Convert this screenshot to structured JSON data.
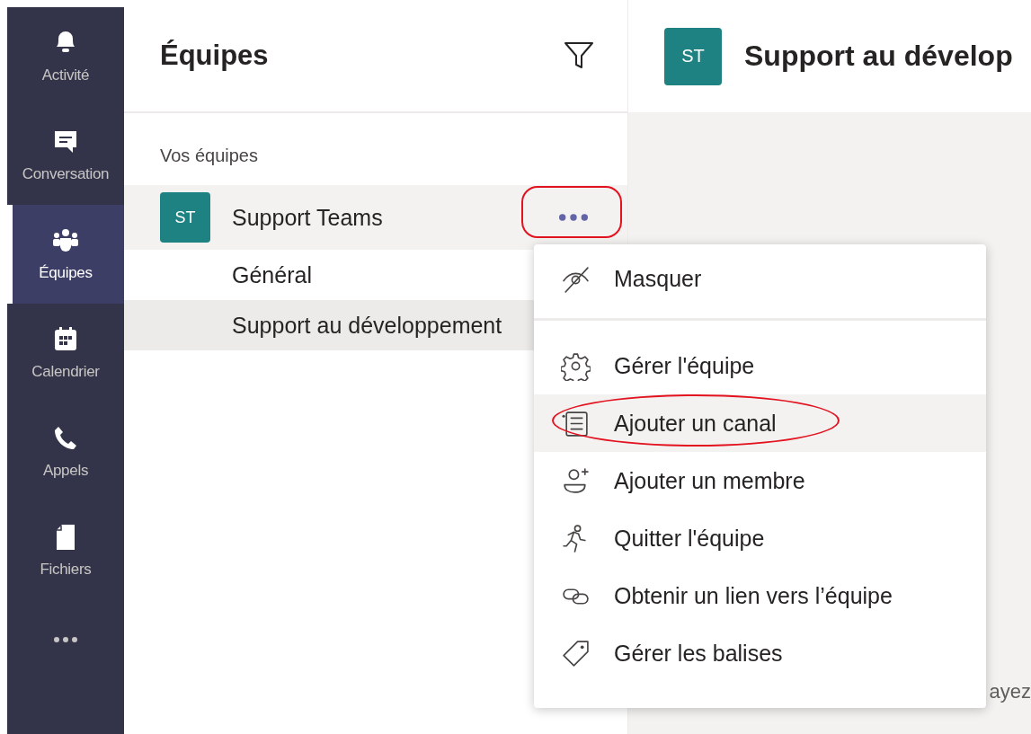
{
  "rail": {
    "items": [
      {
        "label": "Activité",
        "kind": "bell",
        "selected": false
      },
      {
        "label": "Conversation",
        "kind": "chat",
        "selected": false
      },
      {
        "label": "Équipes",
        "kind": "teams",
        "selected": true
      },
      {
        "label": "Calendrier",
        "kind": "calendar",
        "selected": false
      },
      {
        "label": "Appels",
        "kind": "phone",
        "selected": false
      },
      {
        "label": "Fichiers",
        "kind": "file",
        "selected": false
      }
    ]
  },
  "teams_panel": {
    "title": "Équipes",
    "section_label": "Vos équipes",
    "teams": [
      {
        "initials": "ST",
        "name": "Support Teams",
        "hovered": true,
        "more_highlighted": true,
        "channels": [
          {
            "name": "Général",
            "selected": false
          },
          {
            "name": "Support au développement",
            "selected": true
          }
        ]
      }
    ]
  },
  "channel_header": {
    "initials": "ST",
    "title": "Support au dévelop"
  },
  "background_text": "ayez",
  "context_menu": {
    "items": [
      {
        "label": "Masquer",
        "kind": "hide",
        "hovered": false,
        "highlighted": false,
        "separator_after": true
      },
      {
        "label": "Gérer l'équipe",
        "kind": "gear",
        "hovered": false,
        "highlighted": false,
        "separator_after": false
      },
      {
        "label": "Ajouter un canal",
        "kind": "channel",
        "hovered": true,
        "highlighted": true,
        "separator_after": false
      },
      {
        "label": "Ajouter un membre",
        "kind": "person-add",
        "hovered": false,
        "highlighted": false,
        "separator_after": false
      },
      {
        "label": "Quitter l'équipe",
        "kind": "run",
        "hovered": false,
        "highlighted": false,
        "separator_after": false
      },
      {
        "label": "Obtenir un lien vers l’équipe",
        "kind": "link",
        "hovered": false,
        "highlighted": false,
        "separator_after": false
      },
      {
        "label": "Gérer les balises",
        "kind": "tag",
        "hovered": false,
        "highlighted": false,
        "separator_after": false
      }
    ]
  }
}
